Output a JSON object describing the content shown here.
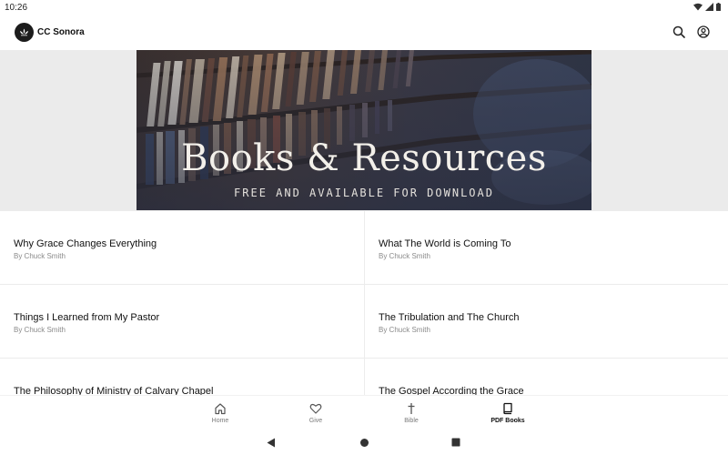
{
  "status_bar": {
    "time": "10:26"
  },
  "app_bar": {
    "title": "CC Sonora"
  },
  "hero": {
    "title": "Books & Resources",
    "subtitle": "FREE AND AVAILABLE FOR DOWNLOAD"
  },
  "books": [
    {
      "title": "Why Grace Changes Everything",
      "author": "By Chuck Smith"
    },
    {
      "title": "What The World is Coming To",
      "author": "By Chuck Smith"
    },
    {
      "title": "Things I Learned from My Pastor",
      "author": "By Chuck Smith"
    },
    {
      "title": "The Tribulation and The Church",
      "author": "By Chuck Smith"
    },
    {
      "title": "The Philosophy of Ministry of Calvary Chapel",
      "author": ""
    },
    {
      "title": "The Gospel According the Grace",
      "author": ""
    }
  ],
  "bottom_nav": {
    "items": [
      {
        "label": "Home",
        "icon": "home-icon"
      },
      {
        "label": "Give",
        "icon": "heart-icon"
      },
      {
        "label": "Bible",
        "icon": "cross-icon"
      },
      {
        "label": "PDF Books",
        "icon": "book-icon"
      }
    ],
    "active": "PDF Books"
  },
  "colors": {
    "hero_band": "#ebebeb",
    "text_primary": "#111111",
    "text_secondary": "#8a8a8a",
    "logo_bg": "#1c1c1c"
  }
}
